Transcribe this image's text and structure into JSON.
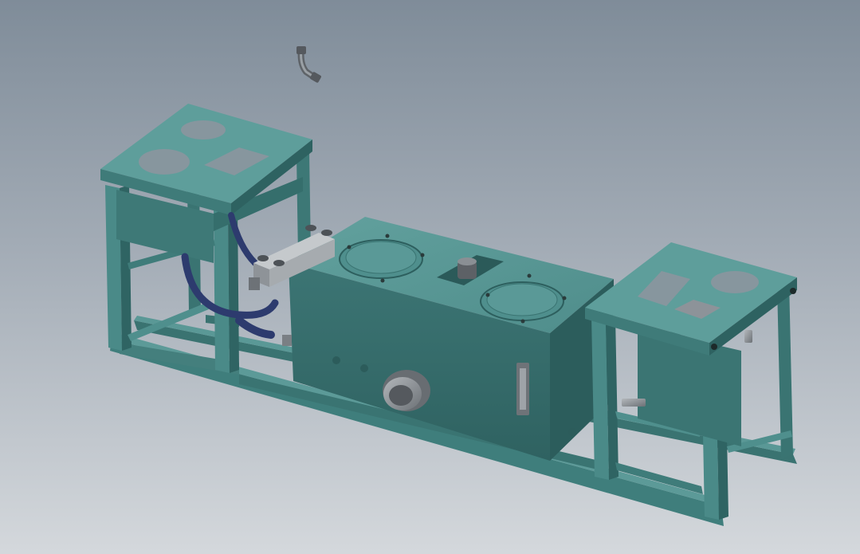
{
  "viewport": {
    "background_top": "#7f8c99",
    "background_bottom": "#d4d8dc"
  },
  "model": {
    "frame_color": "#4f8f8d",
    "frame_dark": "#2f6463",
    "frame_light": "#6aa7a4",
    "tank_color": "#3f7978",
    "hose_color": "#2d3b6e",
    "metal_color": "#8a8f94"
  }
}
